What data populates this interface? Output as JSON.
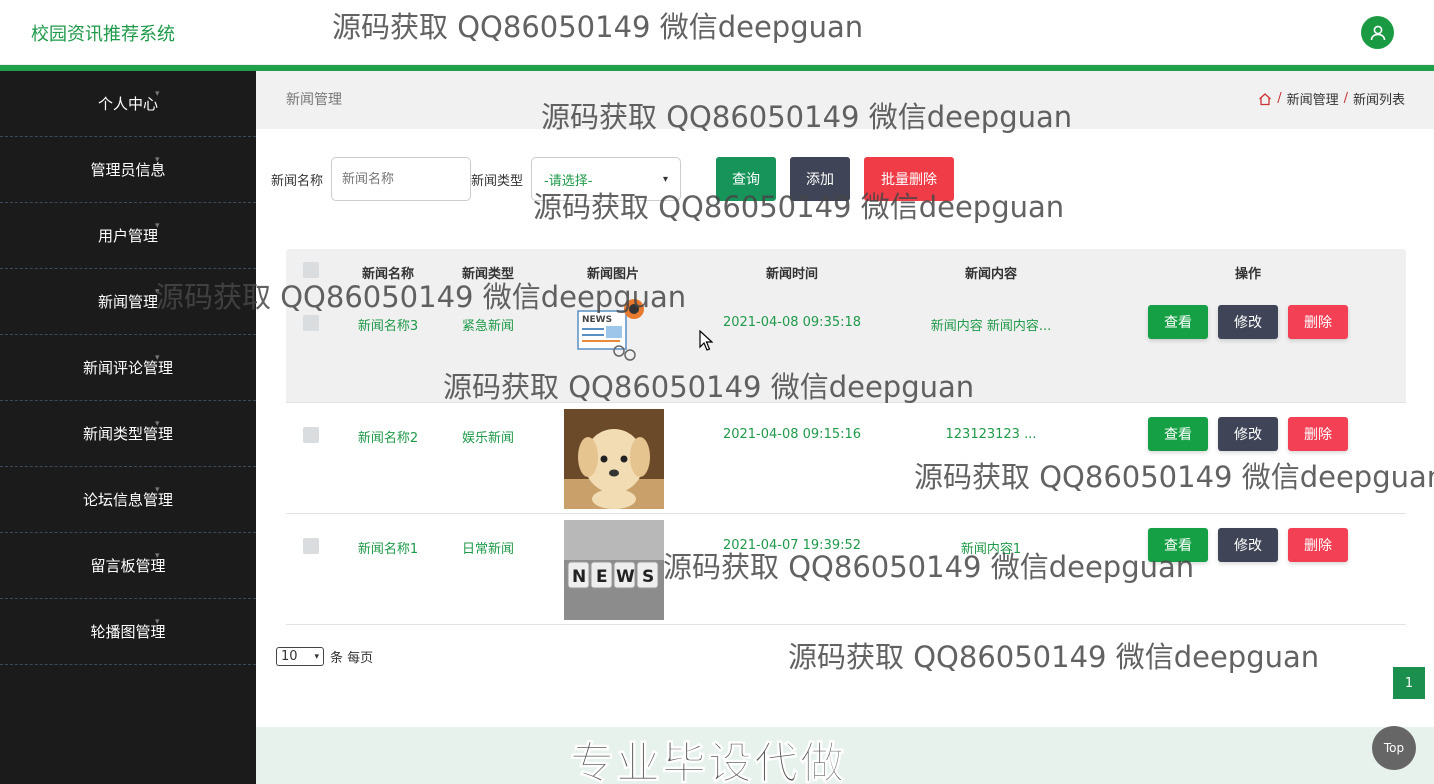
{
  "header": {
    "brand": "校园资讯推荐系统",
    "avatar_icon": "user-icon"
  },
  "sidebar": {
    "items": [
      {
        "label": "个人中心"
      },
      {
        "label": "管理员信息"
      },
      {
        "label": "用户管理"
      },
      {
        "label": "新闻管理"
      },
      {
        "label": "新闻评论管理"
      },
      {
        "label": "新闻类型管理"
      },
      {
        "label": "论坛信息管理"
      },
      {
        "label": "留言板管理"
      },
      {
        "label": "轮播图管理"
      }
    ]
  },
  "breadcrumb": {
    "title": "新闻管理",
    "home_icon": "home-icon",
    "sep": "/",
    "items": [
      "新闻管理",
      "新闻列表"
    ]
  },
  "filter": {
    "name_label": "新闻名称",
    "name_placeholder": "新闻名称",
    "type_label": "新闻类型",
    "type_selected": "-请选择-",
    "search_label": "查询",
    "add_label": "添加",
    "bulk_delete_label": "批量删除"
  },
  "table": {
    "headers": [
      "新闻名称",
      "新闻类型",
      "新闻图片",
      "新闻时间",
      "新闻内容",
      "操作"
    ],
    "rows": [
      {
        "name": "新闻名称3",
        "type": "紧急新闻",
        "time": "2021-04-08 09:35:18",
        "content": "新闻内容 新闻内容..."
      },
      {
        "name": "新闻名称2",
        "type": "娱乐新闻",
        "time": "2021-04-08 09:15:16",
        "content": "123123123 ..."
      },
      {
        "name": "新闻名称1",
        "type": "日常新闻",
        "time": "2021-04-07 19:39:52",
        "content": "新闻内容1"
      }
    ],
    "view_label": "查看",
    "edit_label": "修改",
    "delete_label": "删除"
  },
  "pager": {
    "page_size": "10",
    "suffix": "条 每页",
    "current_page": "1"
  },
  "footer": {
    "text": "专业毕设代做"
  },
  "top_button": "Top",
  "watermark": "源码获取 QQ86050149 微信deepguan",
  "colors": {
    "brand_green": "#1f9a4a",
    "sidebar_bg": "#1b1b1b",
    "delete_red": "#f44055",
    "edit_gray": "#3f4556"
  }
}
